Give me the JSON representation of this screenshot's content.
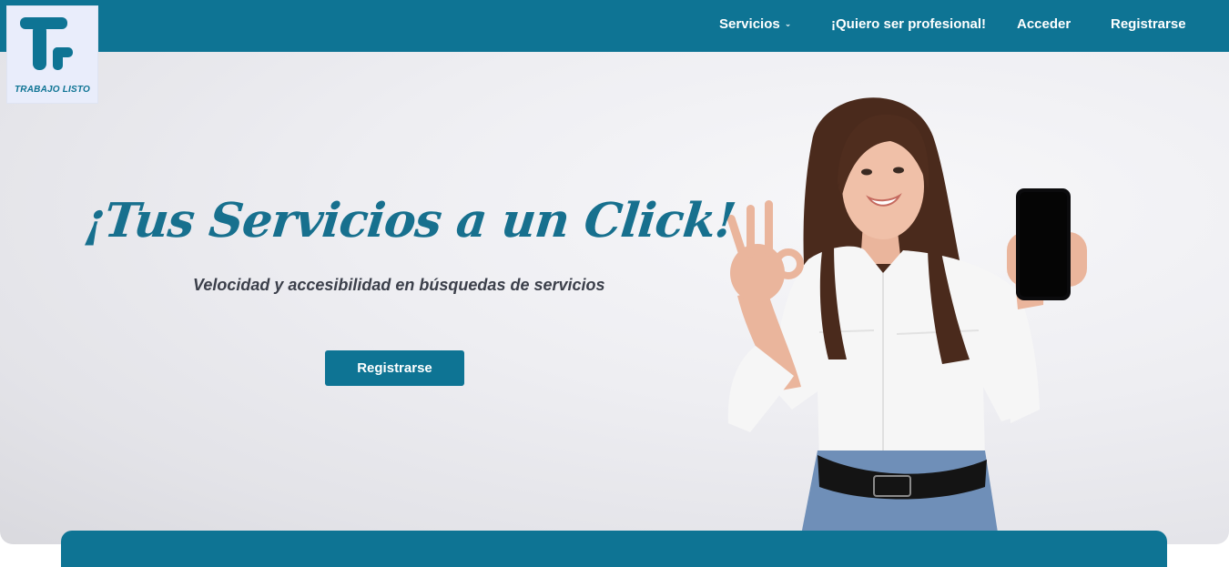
{
  "brand": {
    "name": "TRABAJO LISTO",
    "primary_color": "#0e7494",
    "logo_icon": "tr-monogram-logo"
  },
  "nav": {
    "items": [
      {
        "label": "Servicios",
        "icon": "chevron-down-icon"
      },
      {
        "label": "¡Quiero ser profesional!"
      },
      {
        "label": "Acceder"
      },
      {
        "label": "Registrarse"
      }
    ]
  },
  "hero": {
    "headline": "¡Tus Servicios a un Click!",
    "subheadline": "Velocidad y accesibilidad en búsquedas de servicios",
    "cta_label": "Registrarse"
  }
}
